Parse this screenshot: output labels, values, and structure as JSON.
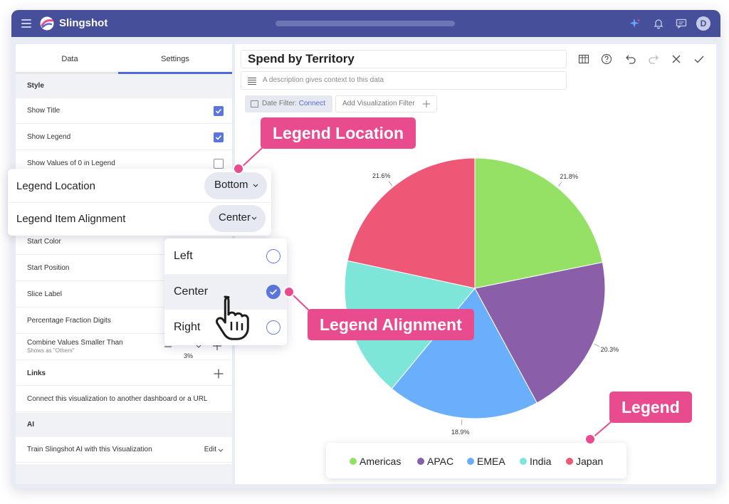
{
  "app": {
    "brand": "Slingshot",
    "avatar_initial": "D"
  },
  "left_panel": {
    "tabs": [
      {
        "label": "Data"
      },
      {
        "label": "Settings"
      }
    ],
    "sections": {
      "style": "Style",
      "links": "Links",
      "ai": "AI"
    },
    "rows": {
      "show_title": "Show Title",
      "show_legend": "Show Legend",
      "show_values_zero": "Show Values of 0 in Legend",
      "start_color": "Start Color",
      "start_position": "Start Position",
      "slice_label": "Slice Label",
      "percentage_digits": "Percentage Fraction Digits",
      "combine_values": "Combine Values Smaller Than",
      "combine_sub": "Shows as \"Others\"",
      "combine_value": "3%",
      "links_text": "Connect this visualization to another dashboard or a URL",
      "ai_text": "Train Slingshot AI with this Visualization",
      "ai_edit": "Edit"
    },
    "checks": {
      "show_title": true,
      "show_legend": true,
      "show_values_zero": false
    }
  },
  "legend_popup": {
    "location_label": "Legend Location",
    "location_value": "Bottom",
    "alignment_label": "Legend Item Alignment",
    "alignment_value": "Center"
  },
  "alignment_options": [
    {
      "label": "Left",
      "selected": false
    },
    {
      "label": "Center",
      "selected": true
    },
    {
      "label": "Right",
      "selected": false
    }
  ],
  "viz": {
    "title": "Spend by Territory",
    "description_placeholder": "A description gives context to this data",
    "date_filter_label": "Date Filter:",
    "date_filter_action": "Connect",
    "add_filter": "Add Visualization Filter"
  },
  "callouts": {
    "location": "Legend Location",
    "alignment": "Legend Alignment",
    "legend": "Legend"
  },
  "colors": {
    "brand_bar": "#454f9a",
    "accent": "#4f6bd9",
    "callout": "#e94b8f"
  },
  "chart_data": {
    "type": "pie",
    "title": "Spend by Territory",
    "legend_position": "bottom",
    "series": [
      {
        "name": "Americas",
        "value": 21.8,
        "label": "21.8%",
        "color": "#94e165"
      },
      {
        "name": "APAC",
        "value": 20.3,
        "label": "20.3%",
        "color": "#8a5ea8"
      },
      {
        "name": "EMEA",
        "value": 18.9,
        "label": "18.9%",
        "color": "#6aaffb"
      },
      {
        "name": "India",
        "value": 17.4,
        "label": "",
        "color": "#7ee6d8"
      },
      {
        "name": "Japan",
        "value": 21.6,
        "label": "21.6%",
        "color": "#ee5876"
      }
    ]
  }
}
